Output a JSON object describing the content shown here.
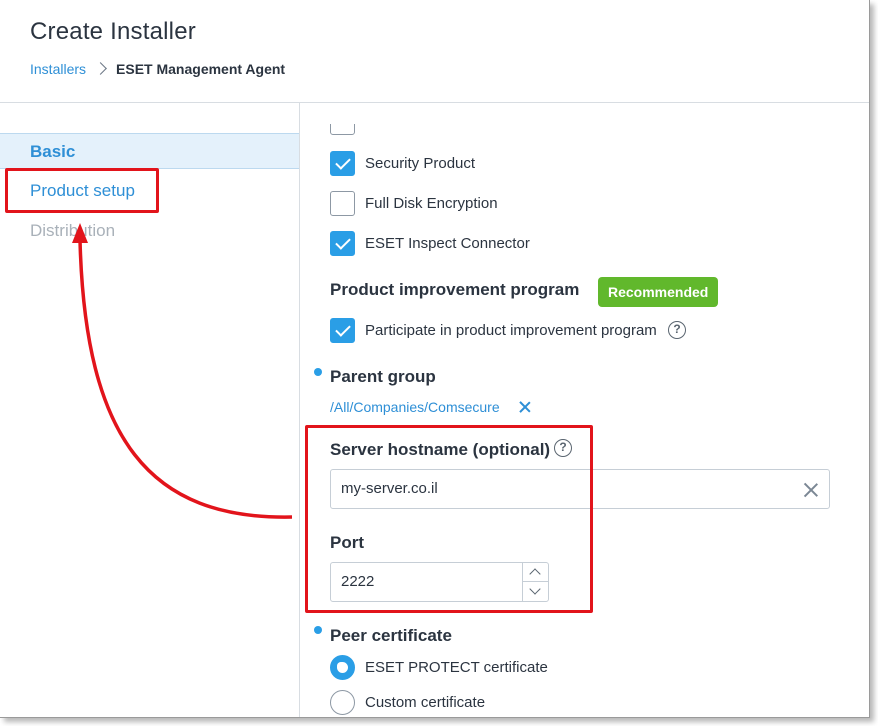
{
  "header": {
    "title": "Create Installer",
    "breadcrumb": {
      "parent": "Installers",
      "current": "ESET Management Agent"
    }
  },
  "nav": {
    "items": [
      {
        "label": "Basic",
        "state": "active"
      },
      {
        "label": "Product setup",
        "state": "highlighted"
      },
      {
        "label": "Distribution",
        "state": "disabled"
      }
    ]
  },
  "products": [
    {
      "label": "Security Product",
      "checked": true
    },
    {
      "label": "Full Disk Encryption",
      "checked": false
    },
    {
      "label": "ESET Inspect Connector",
      "checked": true
    }
  ],
  "improvement": {
    "heading": "Product improvement program",
    "badge": "Recommended",
    "checkbox_label": "Participate in product improvement program",
    "checked": true,
    "help_icon": "?"
  },
  "parent_group": {
    "heading": "Parent group",
    "value": "/All/Companies/Comsecure"
  },
  "server": {
    "label": "Server hostname (optional)",
    "help_icon": "?",
    "value": "my-server.co.il"
  },
  "port": {
    "label": "Port",
    "value": "2222"
  },
  "peer_certificate": {
    "heading": "Peer certificate",
    "options": [
      {
        "label": "ESET PROTECT certificate",
        "selected": true
      },
      {
        "label": "Custom certificate",
        "selected": false
      }
    ]
  },
  "colors": {
    "accent": "#2a9ee6",
    "link": "#2e8fd6",
    "badge": "#61b82c",
    "annotation": "#e2141b"
  }
}
